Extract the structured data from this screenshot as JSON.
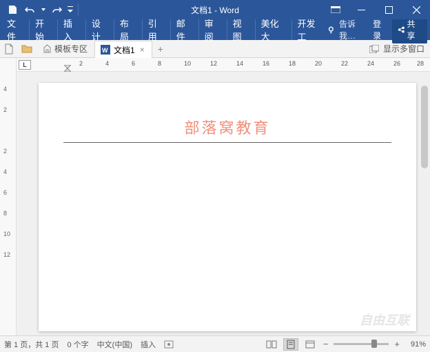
{
  "title": "文档1 - Word",
  "qat": {
    "save": "保存",
    "undo": "撤销",
    "redo": "重做"
  },
  "tabs": [
    "文件",
    "开始",
    "插入",
    "设计",
    "布局",
    "引用",
    "邮件",
    "审阅",
    "视图",
    "美化大",
    "开发工"
  ],
  "tell_me": "告诉我…",
  "login": "登录",
  "share": "共享",
  "template_zone": "模板专区",
  "doc_tab": "文档1",
  "multi_window": "显示多窗口",
  "ruler_L": "L",
  "hruler_ticks": [
    "2",
    "4",
    "6",
    "8",
    "10",
    "12",
    "14",
    "16",
    "18",
    "20",
    "22",
    "24",
    "26",
    "28"
  ],
  "vruler_ticks": [
    "4",
    "2",
    "",
    "2",
    "4",
    "6",
    "8",
    "10",
    "12"
  ],
  "header_text": "部落窝教育",
  "status": {
    "page": "第 1 页，共 1 页",
    "words": "0 个字",
    "lang": "中文(中国)",
    "mode": "插入",
    "zoom": "91%"
  },
  "watermark": "自由互联"
}
